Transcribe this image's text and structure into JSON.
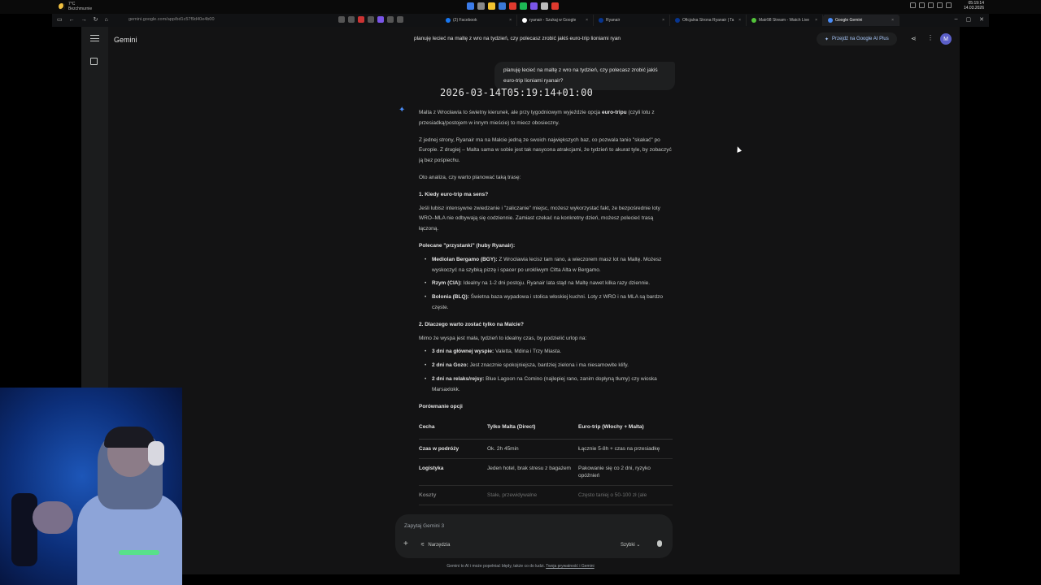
{
  "taskbar": {
    "weather_temp": "7°C",
    "weather_desc": "Bezchmurnie",
    "time": "05:19:14",
    "date": "14.03.2026"
  },
  "browser": {
    "url": "gemini.google.com/app/bd1c57f9d40e4b00",
    "tabs": [
      {
        "label": "(2) Facebook",
        "color": "#1877f2"
      },
      {
        "label": "ryanair - Szukaj w Google",
        "color": "#ffffff"
      },
      {
        "label": "Ryanair",
        "color": "#073590"
      },
      {
        "label": "Oficjalna Strona Ryanair | Ta",
        "color": "#073590"
      },
      {
        "label": "Matr98 Stream - Watch Live",
        "color": "#53c43a"
      },
      {
        "label": "Google Gemini",
        "color": "#4a8cf7"
      }
    ]
  },
  "app": {
    "title": "Gemini",
    "conversation_title": "planuję lecieć na maltę z wro na tydzień, czy polecasz zrobić jakiś euro-trip lioniami ryan",
    "upgrade_label": "Przejdź na Google AI Plus",
    "avatar_letter": "M",
    "user_message": "planuję lecieć na maltę z wro na tydzień, czy polecasz zrobić jakiś euro-trip lioniami ryanair?",
    "timestamp_overlay": "2026-03-14T05:19:14+01:00",
    "response": {
      "p1_a": "Malta z Wrocławia to świetny kierunek, ale przy tygodniowym wyjeździe opcja ",
      "p1_b": "euro-tripu",
      "p1_c": " (czyli lotu z przesiadką/postojem w innym mieście) to miecz obosieczny.",
      "p2": "Z jednej strony, Ryanair ma na Malcie jedną ze swoich największych baz, co pozwala tanio \"skakać\" po Europie. Z drugiej – Malta sama w sobie jest tak nasycona atrakcjami, że tydzień to akurat tyle, by zobaczyć ją bez pośpiechu.",
      "p3": "Oto analiza, czy warto planować taką trasę:",
      "h1": "1. Kiedy euro-trip ma sens?",
      "p4": "Jeśli lubisz intensywne zwiedzanie i \"zaliczanie\" miejsc, możesz wykorzystać fakt, że bezpośrednie loty WRO–MLA nie odbywają się codziennie. Zamiast czekać na konkretny dzień, możesz polecieć trasą łączoną.",
      "h2": "Polecane \"przystanki\" (huby Ryanair):",
      "stops": [
        {
          "name": "Mediolan Bergamo (BGY):",
          "text": " Z Wrocławia lecisz tam rano, a wieczorem masz lot na Maltę. Możesz wyskoczyć na szybką pizzę i spacer po urokliwym Citta Alta w Bergamo."
        },
        {
          "name": "Rzym (CIA):",
          "text": " Idealny na 1-2 dni postoju. Ryanair lata stąd na Maltę nawet kilka razy dziennie."
        },
        {
          "name": "Bolonia (BLQ):",
          "text": " Świetna baza wypadowa i stolica włoskiej kuchni. Loty z WRO i na MLA są bardzo częste."
        }
      ],
      "h3": "2. Dlaczego warto zostać tylko na Malcie?",
      "p5": "Mimo że wyspa jest mała, tydzień to idealny czas, by podzielić urlop na:",
      "plan": [
        {
          "name": "3 dni na głównej wyspie:",
          "text": " Valetta, Mdina i Trzy Miasta."
        },
        {
          "name": "2 dni na Gozo:",
          "text": " Jest znacznie spokojniejsza, bardziej zielona i ma niesamowite klify."
        },
        {
          "name": "2 dni na relaks/rejsy:",
          "text": " Blue Lagoon na Comino (najlepiej rano, zanim dopłyną tłumy) czy wioska Marsaxlokk."
        }
      ],
      "h4": "Porównanie opcji",
      "table": {
        "headers": [
          "Cecha",
          "Tylko Malta (Direct)",
          "Euro-trip (Włochy + Malta)"
        ],
        "rows": [
          [
            "Czas w podróży",
            "Ok. 2h 45min",
            "Łącznie 5-8h + czas na przesiadkę"
          ],
          [
            "Logistyka",
            "Jeden hotel, brak stresu z bagażem",
            "Pakowanie się co 2 dni, ryzyko opóźnień"
          ],
          [
            "Koszty",
            "Stałe, przewidywalne",
            "Często taniej o 50-100 zł (ale"
          ]
        ]
      }
    },
    "input": {
      "placeholder": "Zapytaj Gemini 3",
      "tools_label": "Narzędzia",
      "mode_label": "Szybki"
    },
    "disclaimer": "Gemini to AI i może popełniać błędy, także co do ludzi.",
    "disclaimer_link": "Twoja prywatność i Gemini"
  }
}
